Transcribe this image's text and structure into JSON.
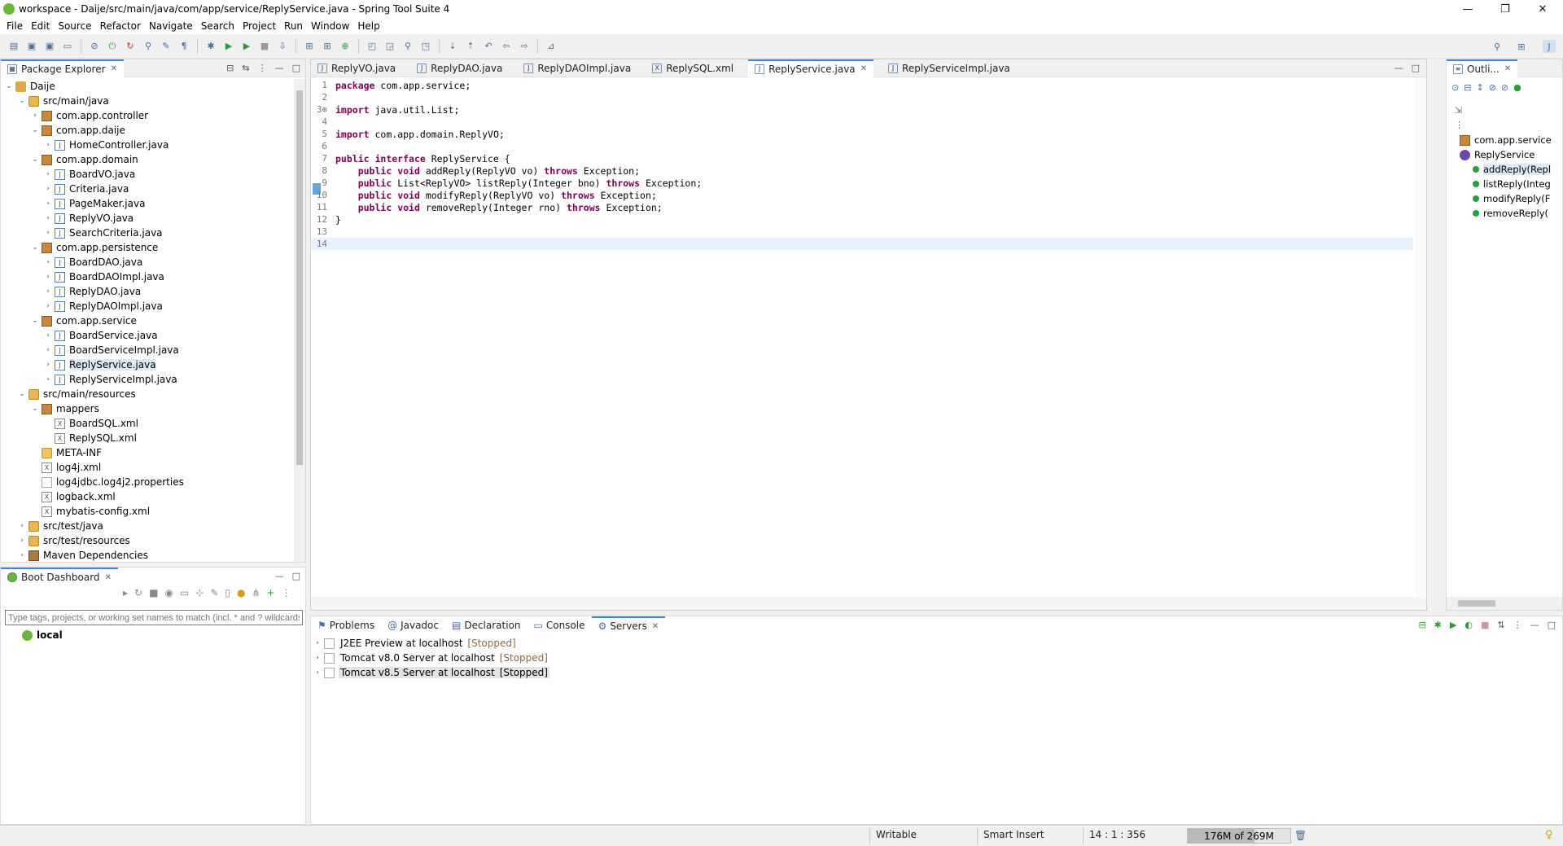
{
  "window": {
    "title": "workspace - Daije/src/main/java/com/app/service/ReplyService.java - Spring Tool Suite 4",
    "minimize": "—",
    "maximize": "❐",
    "close": "✕"
  },
  "menu": [
    "File",
    "Edit",
    "Source",
    "Refactor",
    "Navigate",
    "Search",
    "Project",
    "Run",
    "Window",
    "Help"
  ],
  "package_explorer": {
    "title": "Package Explorer",
    "tree": [
      {
        "label": "Daije",
        "level": 0,
        "arrow": "v",
        "icon": "prj"
      },
      {
        "label": "src/main/java",
        "level": 1,
        "arrow": "v",
        "icon": "src"
      },
      {
        "label": "com.app.controller",
        "level": 2,
        "arrow": ">",
        "icon": "pkg"
      },
      {
        "label": "com.app.daije",
        "level": 2,
        "arrow": "v",
        "icon": "pkg"
      },
      {
        "label": "HomeController.java",
        "level": 3,
        "arrow": ">",
        "icon": "java"
      },
      {
        "label": "com.app.domain",
        "level": 2,
        "arrow": "v",
        "icon": "pkg"
      },
      {
        "label": "BoardVO.java",
        "level": 3,
        "arrow": ">",
        "icon": "java"
      },
      {
        "label": "Criteria.java",
        "level": 3,
        "arrow": ">",
        "icon": "java"
      },
      {
        "label": "PageMaker.java",
        "level": 3,
        "arrow": ">",
        "icon": "java"
      },
      {
        "label": "ReplyVO.java",
        "level": 3,
        "arrow": ">",
        "icon": "java"
      },
      {
        "label": "SearchCriteria.java",
        "level": 3,
        "arrow": ">",
        "icon": "java"
      },
      {
        "label": "com.app.persistence",
        "level": 2,
        "arrow": "v",
        "icon": "pkg"
      },
      {
        "label": "BoardDAO.java",
        "level": 3,
        "arrow": ">",
        "icon": "java"
      },
      {
        "label": "BoardDAOImpl.java",
        "level": 3,
        "arrow": ">",
        "icon": "java"
      },
      {
        "label": "ReplyDAO.java",
        "level": 3,
        "arrow": ">",
        "icon": "java"
      },
      {
        "label": "ReplyDAOImpl.java",
        "level": 3,
        "arrow": ">",
        "icon": "java"
      },
      {
        "label": "com.app.service",
        "level": 2,
        "arrow": "v",
        "icon": "pkg"
      },
      {
        "label": "BoardService.java",
        "level": 3,
        "arrow": ">",
        "icon": "java"
      },
      {
        "label": "BoardServiceImpl.java",
        "level": 3,
        "arrow": ">",
        "icon": "java"
      },
      {
        "label": "ReplyService.java",
        "level": 3,
        "arrow": ">",
        "icon": "java",
        "selected": true
      },
      {
        "label": "ReplyServiceImpl.java",
        "level": 3,
        "arrow": ">",
        "icon": "java"
      },
      {
        "label": "src/main/resources",
        "level": 1,
        "arrow": "v",
        "icon": "src"
      },
      {
        "label": "mappers",
        "level": 2,
        "arrow": "v",
        "icon": "pkg"
      },
      {
        "label": "BoardSQL.xml",
        "level": 3,
        "arrow": "",
        "icon": "xml"
      },
      {
        "label": "ReplySQL.xml",
        "level": 3,
        "arrow": "",
        "icon": "xml"
      },
      {
        "label": "META-INF",
        "level": 2,
        "arrow": "",
        "icon": "fold"
      },
      {
        "label": "log4j.xml",
        "level": 2,
        "arrow": "",
        "icon": "xml"
      },
      {
        "label": "log4jdbc.log4j2.properties",
        "level": 2,
        "arrow": "",
        "icon": "file"
      },
      {
        "label": "logback.xml",
        "level": 2,
        "arrow": "",
        "icon": "xml"
      },
      {
        "label": "mybatis-config.xml",
        "level": 2,
        "arrow": "",
        "icon": "xml"
      },
      {
        "label": "src/test/java",
        "level": 1,
        "arrow": ">",
        "icon": "src"
      },
      {
        "label": "src/test/resources",
        "level": 1,
        "arrow": ">",
        "icon": "src"
      },
      {
        "label": "Maven Dependencies",
        "level": 1,
        "arrow": ">",
        "icon": "lib"
      }
    ]
  },
  "boot_dashboard": {
    "title": "Boot Dashboard",
    "filter_placeholder": "Type tags, projects, or working set names to match (incl. * and ? wildcards)",
    "item": "local"
  },
  "editor": {
    "tabs": [
      {
        "label": "ReplyVO.java",
        "icon": "J"
      },
      {
        "label": "ReplyDAO.java",
        "icon": "J"
      },
      {
        "label": "ReplyDAOImpl.java",
        "icon": "J"
      },
      {
        "label": "ReplySQL.xml",
        "icon": "X"
      },
      {
        "label": "ReplyService.java",
        "icon": "J",
        "active": true
      },
      {
        "label": "ReplyServiceImpl.java",
        "icon": "J"
      }
    ],
    "lines": [
      {
        "n": "1",
        "t": "package com.app.service;"
      },
      {
        "n": "2",
        "t": ""
      },
      {
        "n": "3⊕",
        "t": "import java.util.List;"
      },
      {
        "n": "4",
        "t": ""
      },
      {
        "n": "5",
        "t": "import com.app.domain.ReplyVO;"
      },
      {
        "n": "6",
        "t": ""
      },
      {
        "n": "7",
        "t": "public interface ReplyService {"
      },
      {
        "n": "8",
        "t": "    public void addReply(ReplyVO vo) throws Exception;"
      },
      {
        "n": "9",
        "t": "    public List<ReplyVO> listReply(Integer bno) throws Exception;"
      },
      {
        "n": "10",
        "t": "    public void modifyReply(ReplyVO vo) throws Exception;"
      },
      {
        "n": "11",
        "t": "    public void removeReply(Integer rno) throws Exception;"
      },
      {
        "n": "12",
        "t": "}"
      },
      {
        "n": "13",
        "t": ""
      },
      {
        "n": "14",
        "t": ""
      }
    ]
  },
  "outline": {
    "title": "Outli...",
    "items": [
      {
        "label": "com.app.service",
        "level": 0
      },
      {
        "label": "ReplyService",
        "level": 0
      },
      {
        "label": "addReply(Repl",
        "level": 1,
        "selected": true
      },
      {
        "label": "listReply(Integ",
        "level": 1
      },
      {
        "label": "modifyReply(F",
        "level": 1
      },
      {
        "label": "removeReply(",
        "level": 1
      }
    ]
  },
  "bottom": {
    "tabs": [
      "Problems",
      "Javadoc",
      "Declaration",
      "Console",
      "Servers"
    ],
    "active_tab": "Servers",
    "servers": [
      {
        "name": "J2EE Preview at localhost",
        "state": "[Stopped]"
      },
      {
        "name": "Tomcat v8.0 Server at localhost",
        "state": "[Stopped]"
      },
      {
        "name": "Tomcat v8.5 Server at localhost",
        "state": "[Stopped]",
        "selected": true
      }
    ]
  },
  "status": {
    "writable": "Writable",
    "insert": "Smart Insert",
    "position": "14 : 1 : 356",
    "heap": "176M of 269M",
    "heap_used_fraction": 0.65
  }
}
